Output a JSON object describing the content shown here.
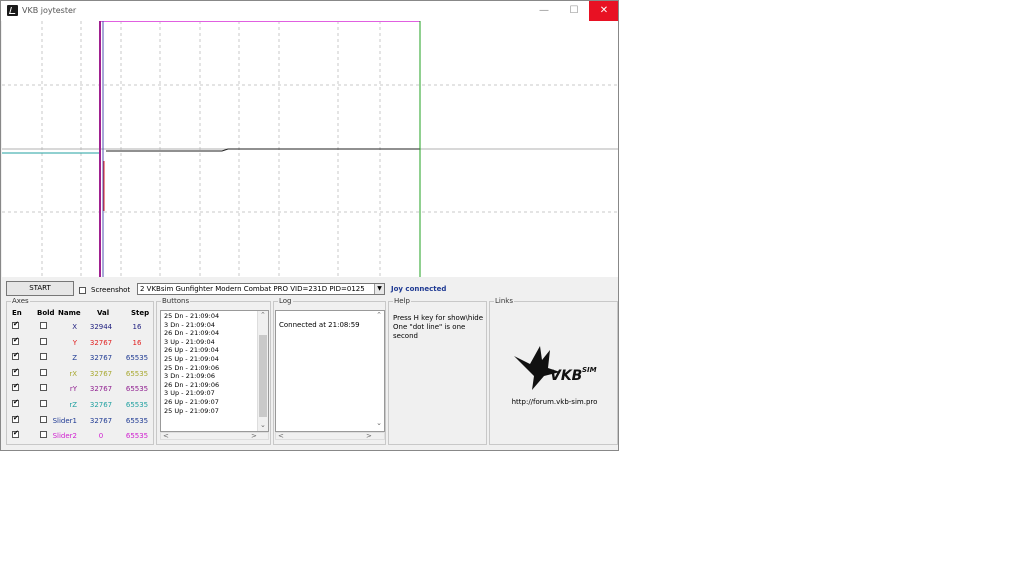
{
  "window": {
    "title": "VKB joytester",
    "minimize_glyph": "—",
    "maximize_glyph": "☐",
    "close_glyph": "✕"
  },
  "controls": {
    "start_label": "START",
    "screenshot_label": "Screenshot",
    "screenshot_checked": false,
    "device_selected": "2 VKBsim Gunfighter Modern Combat PRO  VID=231D PID=0125",
    "dropdown_glyph": "▼",
    "status": "Joy connected"
  },
  "axes": {
    "label": "Axes",
    "headers": {
      "en": "En",
      "bold": "Bold",
      "name": "Name",
      "val": "Val",
      "step": "Step"
    },
    "rows": [
      {
        "name": "X",
        "val": "32944",
        "step": "16",
        "en": true,
        "bold": false,
        "color": "#202080"
      },
      {
        "name": "Y",
        "val": "32767",
        "step": "16",
        "en": true,
        "bold": false,
        "color": "#e02020"
      },
      {
        "name": "Z",
        "val": "32767",
        "step": "65535",
        "en": true,
        "bold": false,
        "color": "#1f3a93"
      },
      {
        "name": "rX",
        "val": "32767",
        "step": "65535",
        "en": true,
        "bold": false,
        "color": "#a8a830"
      },
      {
        "name": "rY",
        "val": "32767",
        "step": "65535",
        "en": true,
        "bold": false,
        "color": "#902090"
      },
      {
        "name": "rZ",
        "val": "32767",
        "step": "65535",
        "en": true,
        "bold": false,
        "color": "#20a0a0"
      },
      {
        "name": "Slider1",
        "val": "32767",
        "step": "65535",
        "en": true,
        "bold": false,
        "color": "#1f3a93"
      },
      {
        "name": "Slider2",
        "val": "0",
        "step": "65535",
        "en": true,
        "bold": false,
        "color": "#d020d0"
      }
    ]
  },
  "buttons_panel": {
    "label": "Buttons",
    "items": [
      "25 Dn - 21:09:04",
      "3 Dn - 21:09:04",
      "26 Dn - 21:09:04",
      "3 Up - 21:09:04",
      "26 Up - 21:09:04",
      "25 Up - 21:09:04",
      "25 Dn - 21:09:06",
      "3 Dn - 21:09:06",
      "26 Dn - 21:09:06",
      "3 Up - 21:09:07",
      "26 Up - 21:09:07",
      "25 Up - 21:09:07"
    ],
    "scroll_up": "⌃",
    "scroll_down": "⌄",
    "scroll_left": "<",
    "scroll_right": ">"
  },
  "log": {
    "label": "Log",
    "text": "Connected at 21:08:59"
  },
  "help": {
    "label": "Help",
    "line1": "Press H key for show\\hide",
    "line2": "One \"dot line\" is one second"
  },
  "links": {
    "label": "Links",
    "logo_text": "VKBSIM",
    "url": "http://forum.vkb-sim.pro"
  }
}
